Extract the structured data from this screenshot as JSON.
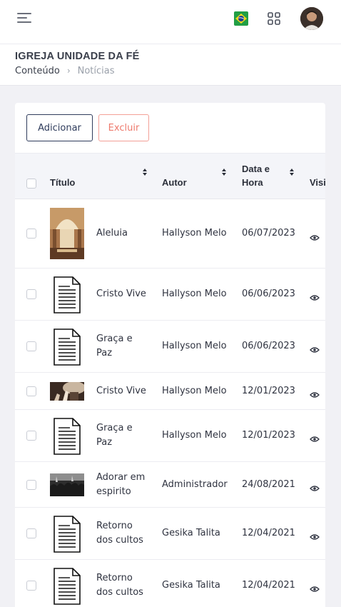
{
  "header": {
    "menu_icon": "hamburger-menu-icon",
    "language_flag": "brazil-flag-icon",
    "apps_icon": "grid-apps-icon",
    "avatar": "user-avatar"
  },
  "page": {
    "organization": "IGREJA UNIDADE DA FÉ",
    "breadcrumb": [
      "Conteúdo",
      "Notícias"
    ]
  },
  "toolbar": {
    "add_label": "Adicionar",
    "delete_label": "Excluir"
  },
  "table": {
    "columns": {
      "title": "Título",
      "author": "Autor",
      "date_line1": "Data e",
      "date_line2": "Hora",
      "views": "Visi"
    },
    "rows": [
      {
        "title_l1": "Aleluia",
        "title_l2": "",
        "author": "Hallyson Melo",
        "date": "06/07/2023",
        "thumb": "photo-church"
      },
      {
        "title_l1": "Cristo Vive",
        "title_l2": "",
        "author": "Hallyson Melo",
        "date": "06/06/2023",
        "thumb": "document"
      },
      {
        "title_l1": "Graça e",
        "title_l2": "Paz",
        "author": "Hallyson Melo",
        "date": "06/06/2023",
        "thumb": "document"
      },
      {
        "title_l1": "Cristo Vive",
        "title_l2": "",
        "author": "Hallyson Melo",
        "date": "12/01/2023",
        "thumb": "photo-hands"
      },
      {
        "title_l1": "Graça e",
        "title_l2": "Paz",
        "author": "Hallyson Melo",
        "date": "12/01/2023",
        "thumb": "document"
      },
      {
        "title_l1": "Adorar em",
        "title_l2": "espirito",
        "author": "Administrador",
        "date": "24/08/2021",
        "thumb": "photo-crowd"
      },
      {
        "title_l1": "Retorno",
        "title_l2": "dos cultos",
        "author": "Gesika Talita",
        "date": "12/04/2021",
        "thumb": "document"
      },
      {
        "title_l1": "Retorno",
        "title_l2": "dos cultos",
        "author": "Gesika Talita",
        "date": "12/04/2021",
        "thumb": "document"
      }
    ]
  },
  "colors": {
    "primary": "#2f3c5c",
    "danger": "#ee7a6d",
    "background": "#f1f1f5"
  }
}
